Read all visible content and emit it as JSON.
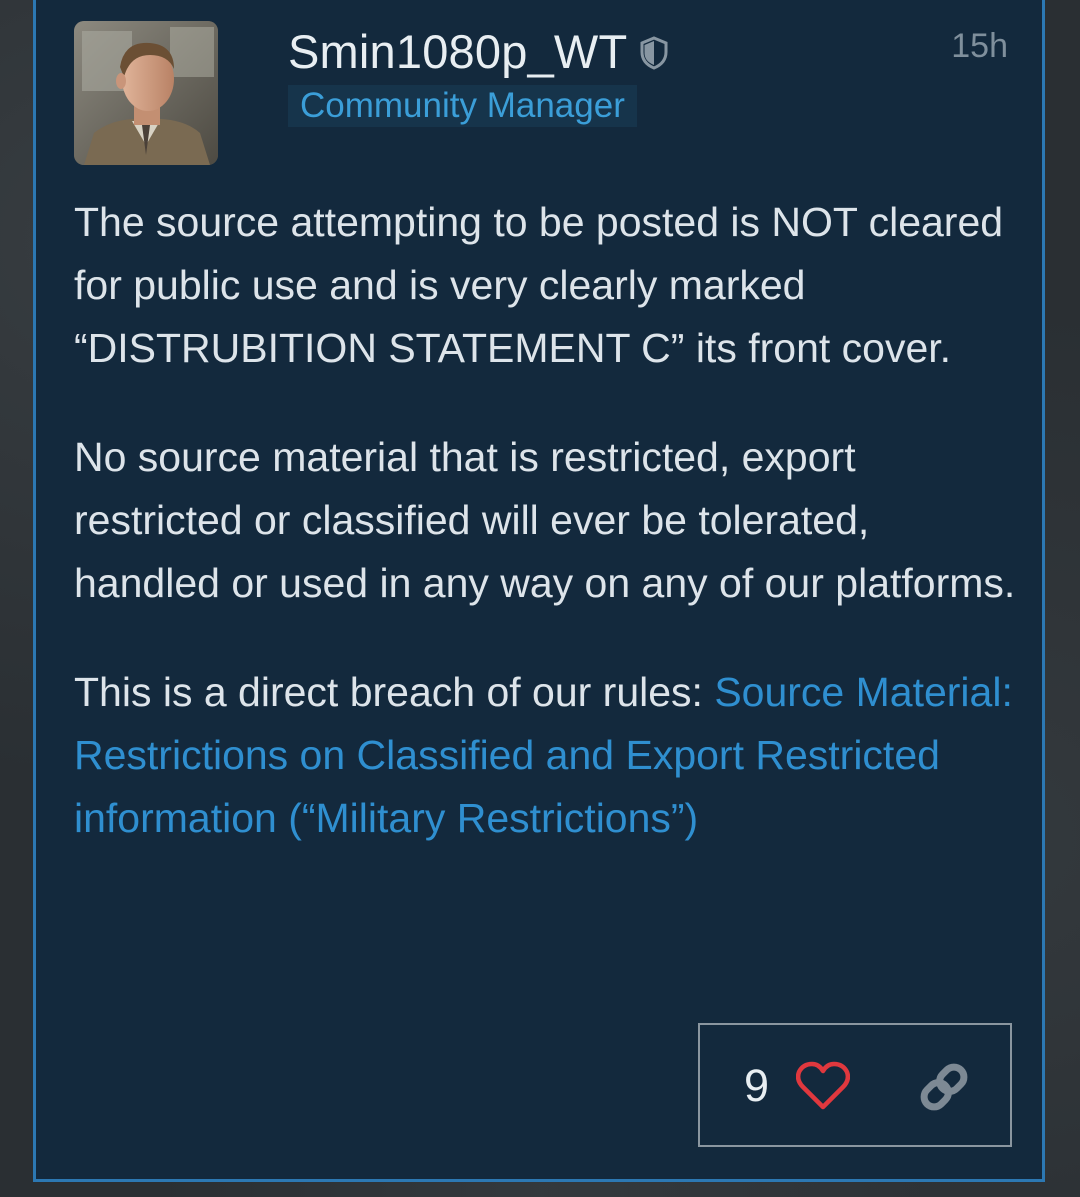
{
  "post": {
    "author": {
      "username": "Smin1080p_WT",
      "role": "Community Manager",
      "moderator_icon": "shield-icon"
    },
    "timestamp": "15h",
    "paragraphs": [
      "The source attempting to be posted is NOT cleared for public use and is very clearly marked “DISTRUBITION STATEMENT C” its front cover.",
      "No source material that is restricted, export restricted or classified will ever be tolerated, handled or used in any way on any of our platforms."
    ],
    "rules_intro": "This is a direct breach of our rules: ",
    "rules_link_text": "Source Material: Restrictions on Classified and Export Restricted information (“Military Restrictions”)",
    "actions": {
      "like_count": "9",
      "like_icon": "heart-icon",
      "share_icon": "link-icon"
    },
    "colors": {
      "card_background": "#13293d",
      "card_border": "#2c78b3",
      "link": "#2f8fd0",
      "role_text": "#3b9ed8",
      "heart": "#e0383e"
    }
  }
}
